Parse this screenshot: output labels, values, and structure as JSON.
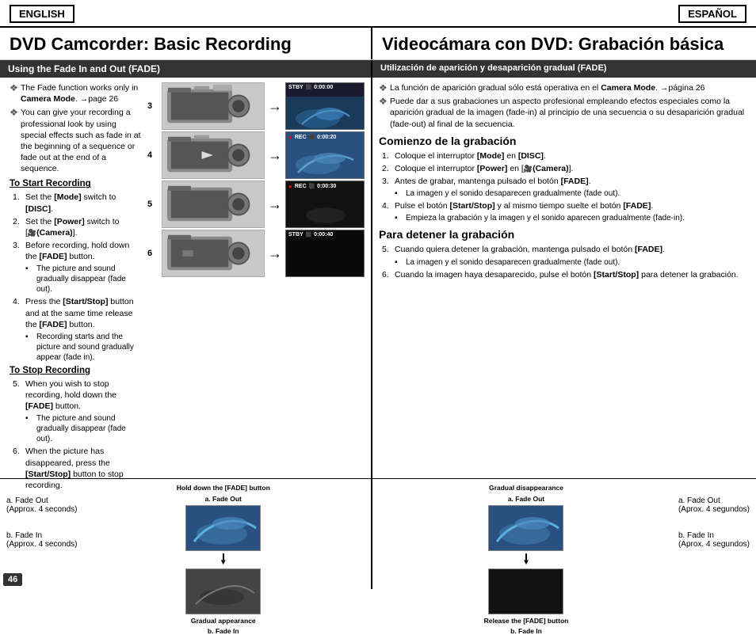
{
  "header": {
    "lang_left": "ENGLISH",
    "lang_right": "ESPAÑOL"
  },
  "title": {
    "left": "DVD Camcorder: Basic Recording",
    "right": "Videocámara con DVD: Grabación básica"
  },
  "section": {
    "left_heading": "Using the Fade In and Out (FADE)",
    "right_heading": "Utilización de aparición y desaparición gradual (FADE)"
  },
  "left_panel": {
    "bullets": [
      "The Fade function works only in Camera Mode. →page 26",
      "You can give your recording a professional look by using special effects such as fade in at the beginning of a sequence or fade out at the end of a sequence."
    ],
    "start_heading": "To Start Recording",
    "start_steps": [
      {
        "num": "1.",
        "text": "Set the [Mode] switch to [DISC]."
      },
      {
        "num": "2.",
        "text": "Set the [Power] switch to [🎥 (Camera)]."
      },
      {
        "num": "3.",
        "text": "Before recording, hold down the [FADE] button.",
        "sub": "The picture and sound gradually disappear (fade out)."
      },
      {
        "num": "4.",
        "text": "Press the [Start/Stop] button and at the same time release the [FADE] button.",
        "sub": "Recording starts and the picture and sound gradually appear (fade in)."
      }
    ],
    "stop_heading": "To Stop Recording",
    "stop_steps": [
      {
        "num": "5.",
        "text": "When you wish to stop recording, hold down the [FADE] button.",
        "sub": "The picture and sound gradually disappear (fade out)."
      },
      {
        "num": "6.",
        "text": "When the picture has disappeared, press the [Start/Stop] button to stop recording."
      }
    ]
  },
  "right_panel": {
    "bullets": [
      "La función de aparición gradual sólo está operativa en el Camera Mode. →página 26",
      "Puede dar a sus grabaciones un aspecto profesional empleando efectos especiales como la aparición gradual de la imagen (fade-in) al principio de una secuencia o su desaparición gradual (fade-out) al final de la secuencia."
    ],
    "start_heading": "Comienzo de la grabación",
    "start_steps": [
      {
        "num": "1.",
        "text": "Coloque el interruptor [Mode] en [DISC]."
      },
      {
        "num": "2.",
        "text": "Coloque el interruptor [Power] en [🎥 (Camera)]."
      },
      {
        "num": "3.",
        "text": "Antes de grabar, mantenga pulsado el botón [FADE].",
        "sub": "La imagen y el sonido desaparecen gradualmente (fade out)."
      },
      {
        "num": "4.",
        "text": "Pulse el botón [Start/Stop] y al mismo tiempo suelte el botón [FADE].",
        "sub": "Empieza la grabación y la imagen y el sonido aparecen gradualmente (fade-in)."
      }
    ],
    "stop_heading": "Para detener la grabación",
    "stop_steps": [
      {
        "num": "5.",
        "text": "Cuando quiera detener la grabación, mantenga pulsado el botón [FADE].",
        "sub": "La imagen y el sonido desaparecen gradualmente (fade out)."
      },
      {
        "num": "6.",
        "text": "Cuando la imagen haya desaparecido, pulse el botón [Start/Stop] para detener la grabación."
      }
    ]
  },
  "bottom": {
    "hold_label": "Hold down the [FADE] button",
    "fade_out_label_a": "a. Fade Out",
    "gradual_disappear": "Gradual disappearance",
    "release_label": "Release the [FADE] button",
    "gradual_appear": "Gradual appearance",
    "fade_in_label_b": "b. Fade In",
    "left_fade_a": "a. Fade Out",
    "left_fade_a_time": "(Approx. 4 seconds)",
    "left_fade_b": "b. Fade In",
    "left_fade_b_time": "(Approx. 4 seconds)",
    "right_fade_a": "a. Fade Out",
    "right_fade_a_time": "(Aprox. 4 segundos)",
    "right_fade_b": "b. Fade In",
    "right_fade_b_time": "(Aprox. 4 segundos)"
  },
  "steps": {
    "step3_status": "STBY",
    "step3_time": "0:00:00",
    "step4_status": "REC",
    "step4_time": "0:00:20",
    "step5_status": "REC",
    "step5_time": "0:00:30",
    "step6_status": "STBY",
    "step6_time": "0:00:40"
  },
  "page_num": "46"
}
